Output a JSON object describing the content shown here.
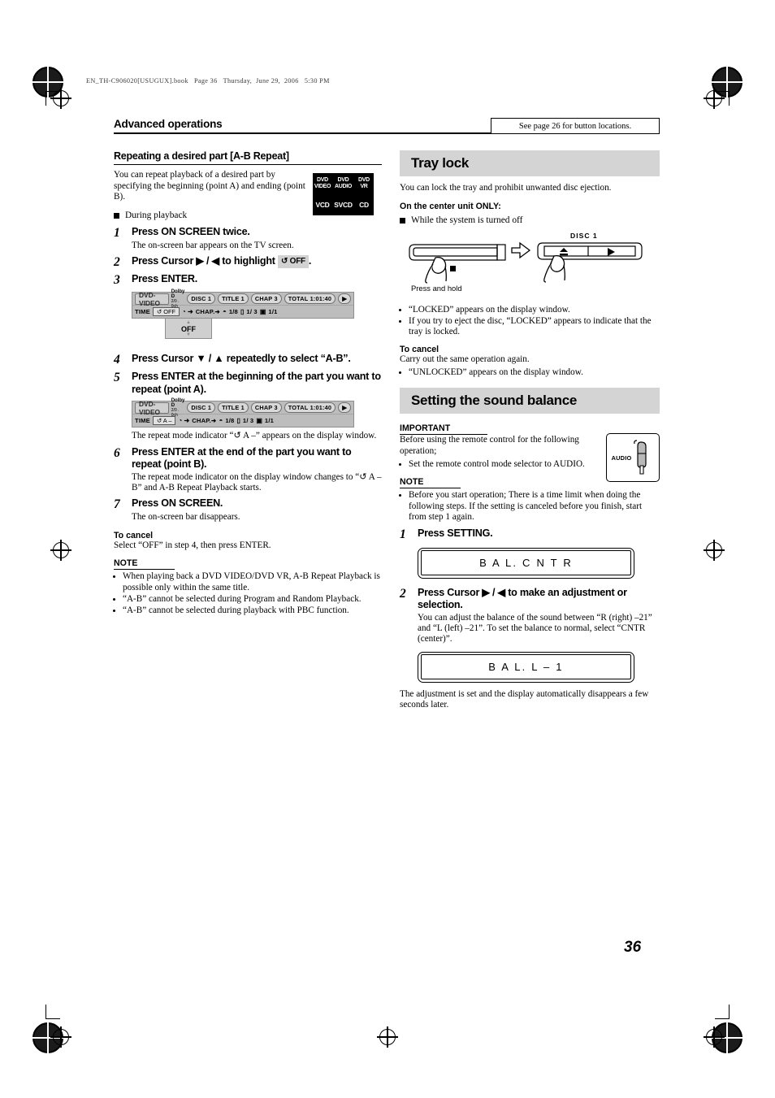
{
  "file_header": "EN_TH-C906020[USUGUX].book   Page 36   Thursday,  June 29,  2006   5:30 PM",
  "page_number": "36",
  "section": {
    "title": "Advanced operations",
    "see_page_note": "See page 26 for button locations."
  },
  "left_column": {
    "heading": "Repeating a desired part [A-B Repeat]",
    "intro": "You can repeat playback of a desired part by specifying the beginning (point A) and ending (point B).",
    "disc_badges": [
      "DVD VIDEO",
      "DVD AUDIO",
      "DVD VR",
      "VCD",
      "SVCD",
      "CD"
    ],
    "badges": {
      "dvd_video_1": "DVD",
      "dvd_video_2": "VIDEO",
      "dvd_audio_1": "DVD",
      "dvd_audio_2": "AUDIO",
      "dvd_vr_1": "DVD",
      "dvd_vr_2": "VR",
      "vcd": "VCD",
      "svcd": "SVCD",
      "cd": "CD"
    },
    "during_playback": "During playback",
    "steps": [
      {
        "num": "1",
        "text": "Press ON SCREEN twice.",
        "desc": "The on-screen bar appears on the TV screen."
      },
      {
        "num": "2",
        "text_pre": "Press Cursor ▶ / ◀ to highlight",
        "highlight": "↺ OFF",
        "text_post": "."
      },
      {
        "num": "3",
        "text": "Press ENTER.",
        "desc": ""
      },
      {
        "num": "4",
        "text": "Press Cursor ▼ / ▲ repeatedly to select “A-B”.",
        "desc": ""
      },
      {
        "num": "5",
        "text": "Press ENTER at the beginning of the part you want to repeat (point A).",
        "desc_pre": "The repeat mode indicator “",
        "desc_ind": "↺ A –",
        "desc_post": "” appears on the display window."
      },
      {
        "num": "6",
        "text": "Press ENTER at the end of the part you want to repeat (point B).",
        "desc_pre": "The repeat mode indicator on the display window changes to “",
        "desc_ind": "↺ A – B",
        "desc_post": "” and A-B Repeat Playback starts."
      },
      {
        "num": "7",
        "text": "Press ON SCREEN.",
        "desc": "The on-screen bar disappears."
      }
    ],
    "osd_bar_1": {
      "disc_type": "DVD-VIDEO",
      "audio_format_line1": "Dolby D",
      "audio_format_line2": "2/0 . 0ch",
      "disc": "DISC 1",
      "title": "TITLE 1",
      "chapter": "CHAP 3",
      "total_label": "TOTAL",
      "total_time": "1:01:40",
      "row2": {
        "time": "TIME",
        "repeat": "↺ OFF",
        "clock": "◔ ➜",
        "chap": "CHAP.➜",
        "audio": "1/8",
        "subtitle": "1/ 3",
        "angle": "1/1"
      },
      "dropdown": "OFF"
    },
    "osd_bar_2": {
      "disc_type": "DVD-VIDEO",
      "audio_format_line1": "Dolby D",
      "audio_format_line2": "2/0 . 0ch",
      "disc": "DISC 1",
      "title": "TITLE 1",
      "chapter": "CHAP 3",
      "total_label": "TOTAL",
      "total_time": "1:01:40",
      "row2": {
        "time": "TIME",
        "repeat": "↺ A –",
        "clock": "◔ ➜",
        "chap": "CHAP.➜",
        "audio": "1/8",
        "subtitle": "1/ 3",
        "angle": "1/1"
      }
    },
    "to_cancel": {
      "label": "To cancel",
      "text": "Select “OFF” in step 4, then press ENTER."
    },
    "note": {
      "label": "NOTE",
      "items": [
        "When playing back a DVD VIDEO/DVD VR, A-B Repeat Playback is possible only within the same title.",
        "“A-B” cannot be selected during Program and Random Playback.",
        "“A-B” cannot be selected during playback with PBC function."
      ]
    }
  },
  "right_column": {
    "tray_lock": {
      "banner": "Tray lock",
      "intro": "You can lock the tray and prohibit unwanted disc ejection.",
      "center_unit_label": "On the center unit ONLY:",
      "while_off": "While the system is turned off",
      "illustration": {
        "press_and_hold": "Press and hold",
        "disc_label": "DISC  1"
      },
      "bullets": [
        "“LOCKED” appears on the display window.",
        "If you try to eject the disc, “LOCKED” appears to indicate that the tray is locked."
      ],
      "to_cancel": {
        "label": "To cancel",
        "text": "Carry out the same operation again.",
        "bullets": [
          "“UNLOCKED” appears on the display window."
        ]
      }
    },
    "sound_balance": {
      "banner": "Setting the sound balance",
      "important": {
        "label": "IMPORTANT",
        "text": "Before using the remote control for the following operation;",
        "bullets": [
          "Set the remote control mode selector to AUDIO."
        ]
      },
      "audio_selector_label": "AUDIO",
      "note": {
        "label": "NOTE",
        "bullets": [
          "Before you start operation; There is a time limit when doing the following steps. If the setting is canceled before you finish, start from step 1 again."
        ]
      },
      "steps": [
        {
          "num": "1",
          "text": "Press SETTING."
        },
        {
          "num": "2",
          "text": "Press Cursor ▶ / ◀ to make an adjustment or selection.",
          "desc": "You can adjust the balance of the sound between “R (right) –21” and “L (left) –21”. To set the balance to normal, select “CNTR (center)”."
        }
      ],
      "display_1": "B A L.   C N T R",
      "display_2": "B A L.   L     – 1",
      "closing_text": "The adjustment is set and the display automatically disappears a few seconds later."
    }
  }
}
